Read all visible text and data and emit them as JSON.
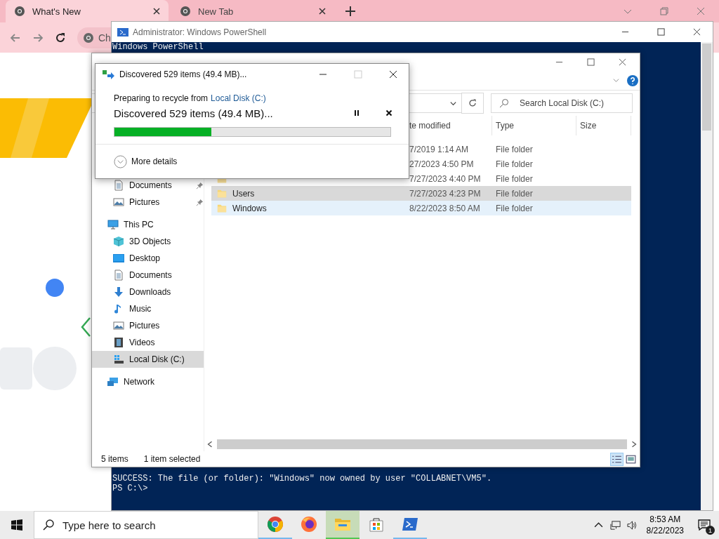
{
  "browser": {
    "tabs": [
      {
        "label": "What's New",
        "selected": true
      },
      {
        "label": "New Tab",
        "selected": false
      }
    ],
    "address_text": "Ch"
  },
  "powershell": {
    "title": "Administrator: Windows PowerShell",
    "header_line": "Windows PowerShell",
    "lines": [
      "SUCCESS: The file (or folder): \"Windows\" now owned by user \"COLLABNET\\VM5\".",
      "PS C:\\>"
    ]
  },
  "explorer": {
    "search": {
      "placeholder": "Search Local Disk (C:)"
    },
    "columns": [
      "te modified",
      "Type",
      "Size"
    ],
    "rows": [
      {
        "date": "7/2019 1:14 AM",
        "type": "File folder",
        "selected": false,
        "hovered": false
      },
      {
        "date": "27/2023 4:50 PM",
        "type": "File folder",
        "selected": false,
        "hovered": false
      },
      {
        "kind": "folder",
        "date": "7/27/2023 4:40 PM",
        "type": "File folder",
        "selected": false,
        "hovered": false
      },
      {
        "kind": "folder",
        "name": "Users",
        "date": "7/27/2023 4:23 PM",
        "type": "File folder",
        "selected": true,
        "hovered": false
      },
      {
        "kind": "folder",
        "name": "Windows",
        "date": "8/22/2023 8:50 AM",
        "type": "File folder",
        "selected": false,
        "hovered": true
      }
    ],
    "quick_access": [
      {
        "label": "Documents",
        "kind": "documents",
        "pinned": true,
        "selected": false
      },
      {
        "label": "Pictures",
        "kind": "pictures",
        "pinned": true,
        "selected": false
      }
    ],
    "tree": [
      {
        "label": "This PC",
        "kind": "pc",
        "selected": false,
        "children": [
          {
            "label": "3D Objects",
            "kind": "objects3d",
            "selected": false
          },
          {
            "label": "Desktop",
            "kind": "desktop",
            "selected": false
          },
          {
            "label": "Documents",
            "kind": "documents",
            "selected": false
          },
          {
            "label": "Downloads",
            "kind": "downloads",
            "selected": false
          },
          {
            "label": "Music",
            "kind": "music",
            "selected": false
          },
          {
            "label": "Pictures",
            "kind": "pictures",
            "selected": false
          },
          {
            "label": "Videos",
            "kind": "videos",
            "selected": false
          },
          {
            "label": "Local Disk (C:)",
            "kind": "disk",
            "selected": true
          }
        ]
      },
      {
        "label": "Network",
        "kind": "network",
        "selected": false
      }
    ],
    "status": {
      "item_count": "5 items",
      "selection": "1 item selected"
    }
  },
  "dialog": {
    "title": "Discovered 529 items (49.4 MB)...",
    "prefix": "Preparing to recycle from",
    "link": "Local Disk (C:)",
    "heading": "Discovered 529 items (49.4 MB)...",
    "level": 0.35,
    "more_details": "More details"
  },
  "taskbar": {
    "search_placeholder": "Type here to search",
    "apps": [
      {
        "kind": "chrome",
        "running": true,
        "active": false
      },
      {
        "kind": "firefox",
        "running": false,
        "active": false
      },
      {
        "kind": "explorer",
        "running": true,
        "active": true
      },
      {
        "kind": "store",
        "running": false,
        "active": false
      },
      {
        "kind": "powershell",
        "running": true,
        "active": false
      }
    ],
    "time": "8:53 AM",
    "date": "8/22/2023",
    "notifications": "1"
  }
}
